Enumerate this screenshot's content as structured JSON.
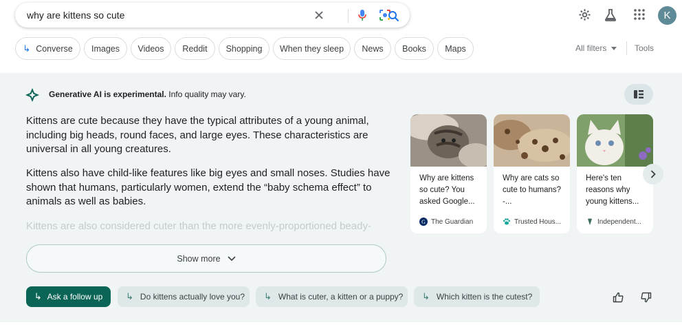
{
  "search": {
    "query": "why are kittens so cute",
    "icons": [
      "clear-icon",
      "microphone-icon",
      "lens-icon",
      "search-icon"
    ]
  },
  "header": {
    "icons": [
      "settings-gear-icon",
      "labs-flask-icon",
      "apps-grid-icon"
    ],
    "avatar_letter": "K"
  },
  "chips": [
    {
      "label": "Converse",
      "arrow": "↳"
    },
    {
      "label": "Images"
    },
    {
      "label": "Videos"
    },
    {
      "label": "Reddit"
    },
    {
      "label": "Shopping"
    },
    {
      "label": "When they sleep"
    },
    {
      "label": "News"
    },
    {
      "label": "Books"
    },
    {
      "label": "Maps"
    }
  ],
  "filters": {
    "all_filters": "All filters",
    "tools": "Tools"
  },
  "sge": {
    "notice_bold": "Generative AI is experimental.",
    "notice_rest": " Info quality may vary.",
    "paragraphs": [
      "Kittens are cute because they have the typical attributes of a young animal, including big heads, round faces, and large eyes. These characteristics are universal in all young creatures.",
      "Kittens also have child-like features like big eyes and small noses. Studies have shown that humans, particularly women, extend the “baby schema effect” to animals as well as babies."
    ],
    "faded_line": "Kittens are also considered cuter than the more evenly-proportioned beady-",
    "show_more": "Show more",
    "cards": [
      {
        "title": "Why are kittens so cute? You asked Google...",
        "source": "The Guardian",
        "source_icon": "guardian-icon"
      },
      {
        "title": "Why are cats so cute to humans? -...",
        "source": "Trusted Hous...",
        "source_icon": "paw-icon"
      },
      {
        "title": "Here's ten reasons why young kittens...",
        "source": "Independent...",
        "source_icon": "independent-icon"
      }
    ],
    "ask_follow_up": "Ask a follow up",
    "follow_ups": [
      "Do kittens actually love you?",
      "What is cuter, a kitten or a puppy?",
      "Which kitten is the cutest?"
    ]
  },
  "colors": {
    "panel_bg": "#f0f4f5",
    "ask_button": "#0b6556",
    "follow_up_chip": "#dfe8e9",
    "accent_blue": "#1a73e8"
  }
}
